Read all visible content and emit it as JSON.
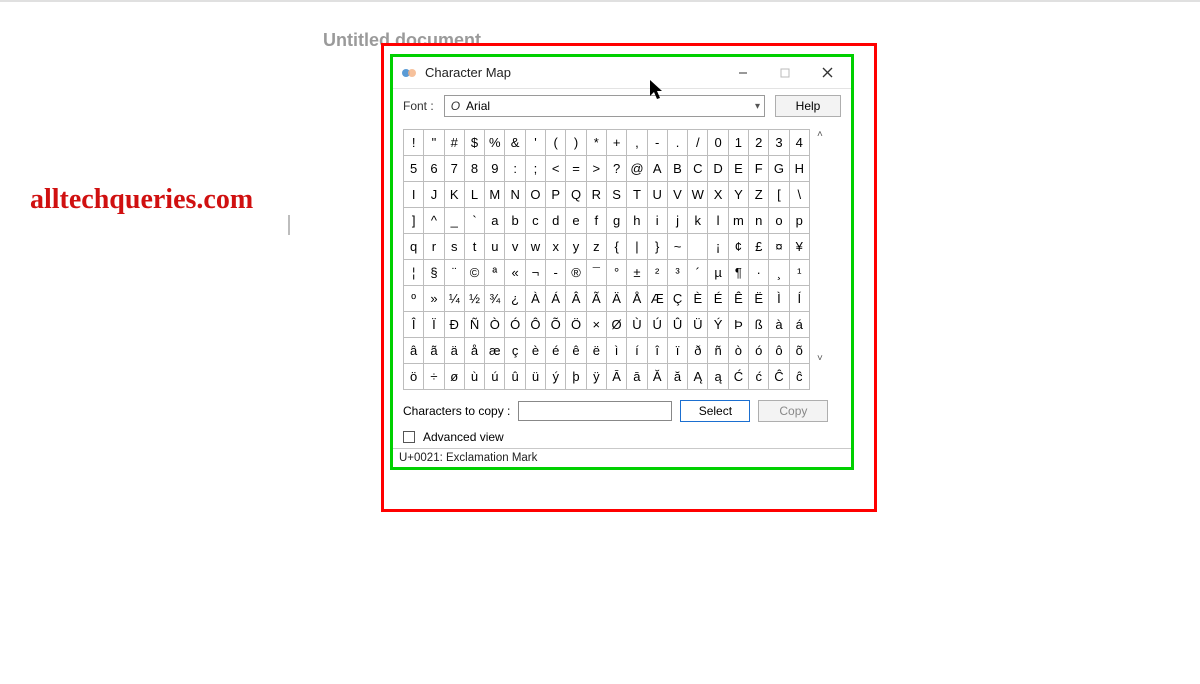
{
  "page": {
    "watermark": "alltechqueries.com",
    "doc_title": "Untitled document"
  },
  "window": {
    "title": "Character Map",
    "font_label": "Font :",
    "font_value": "Arial",
    "font_italic_o": "O",
    "help": "Help",
    "copy_label": "Characters to copy :",
    "select": "Select",
    "copy": "Copy",
    "advanced": "Advanced view",
    "status": "U+0021: Exclamation Mark"
  },
  "chars": [
    "!",
    "\"",
    "#",
    "$",
    "%",
    "&",
    "'",
    "(",
    ")",
    "*",
    "+",
    ",",
    "-",
    ".",
    "/",
    "0",
    "1",
    "2",
    "3",
    "4",
    "5",
    "6",
    "7",
    "8",
    "9",
    ":",
    ";",
    "<",
    "=",
    ">",
    "?",
    "@",
    "A",
    "B",
    "C",
    "D",
    "E",
    "F",
    "G",
    "H",
    "I",
    "J",
    "K",
    "L",
    "M",
    "N",
    "O",
    "P",
    "Q",
    "R",
    "S",
    "T",
    "U",
    "V",
    "W",
    "X",
    "Y",
    "Z",
    "[",
    "\\",
    "]",
    "^",
    "_",
    "`",
    "a",
    "b",
    "c",
    "d",
    "e",
    "f",
    "g",
    "h",
    "i",
    "j",
    "k",
    "l",
    "m",
    "n",
    "o",
    "p",
    "q",
    "r",
    "s",
    "t",
    "u",
    "v",
    "w",
    "x",
    "y",
    "z",
    "{",
    "|",
    "}",
    "~",
    "",
    "¡",
    "¢",
    "£",
    "¤",
    "¥",
    "¦",
    "§",
    "¨",
    "©",
    "ª",
    "«",
    "¬",
    "-",
    "®",
    "¯",
    "°",
    "±",
    "²",
    "³",
    "´",
    "µ",
    "¶",
    "·",
    "¸",
    "¹",
    "º",
    "»",
    "¼",
    "½",
    "¾",
    "¿",
    "À",
    "Á",
    "Â",
    "Ã",
    "Ä",
    "Å",
    "Æ",
    "Ç",
    "È",
    "É",
    "Ê",
    "Ë",
    "Ì",
    "Í",
    "Î",
    "Ï",
    "Đ",
    "Ñ",
    "Ò",
    "Ó",
    "Ô",
    "Õ",
    "Ö",
    "×",
    "Ø",
    "Ù",
    "Ú",
    "Û",
    "Ü",
    "Ý",
    "Þ",
    "ß",
    "à",
    "á",
    "â",
    "ã",
    "ä",
    "å",
    "æ",
    "ç",
    "è",
    "é",
    "ê",
    "ë",
    "ì",
    "í",
    "î",
    "ï",
    "ð",
    "ñ",
    "ò",
    "ó",
    "ô",
    "õ",
    "ö",
    "÷",
    "ø",
    "ù",
    "ú",
    "û",
    "ü",
    "ý",
    "þ",
    "ÿ",
    "Ā",
    "ā",
    "Ă",
    "ă",
    "Ą",
    "ą",
    "Ć",
    "ć",
    "Ĉ",
    "ĉ"
  ]
}
